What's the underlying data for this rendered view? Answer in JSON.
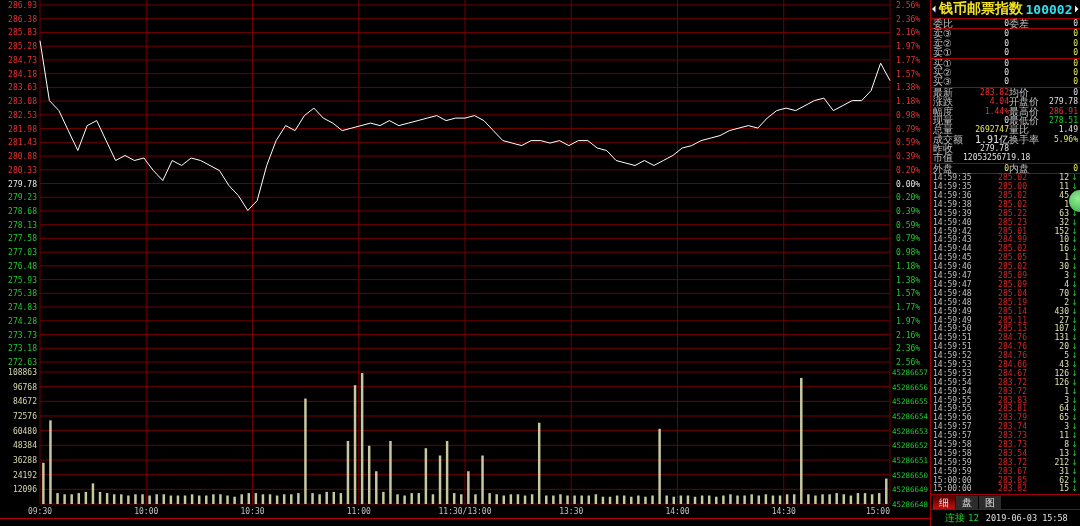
{
  "price_panel": {
    "right_axis": [
      {
        "label": "2.56%",
        "kind": "up"
      },
      {
        "label": "2.36%",
        "kind": "up"
      },
      {
        "label": "2.16%",
        "kind": "up"
      },
      {
        "label": "1.97%",
        "kind": "up"
      },
      {
        "label": "1.77%",
        "kind": "up"
      },
      {
        "label": "1.57%",
        "kind": "up"
      },
      {
        "label": "1.38%",
        "kind": "up"
      },
      {
        "label": "1.18%",
        "kind": "up"
      },
      {
        "label": "0.98%",
        "kind": "up"
      },
      {
        "label": "0.79%",
        "kind": "up"
      },
      {
        "label": "0.59%",
        "kind": "up"
      },
      {
        "label": "0.39%",
        "kind": "up"
      },
      {
        "label": "0.20%",
        "kind": "up"
      },
      {
        "label": "0.00%",
        "kind": "flat"
      },
      {
        "label": "0.20%",
        "kind": "down"
      },
      {
        "label": "0.39%",
        "kind": "down"
      },
      {
        "label": "0.59%",
        "kind": "down"
      },
      {
        "label": "0.79%",
        "kind": "down"
      },
      {
        "label": "0.98%",
        "kind": "down"
      },
      {
        "label": "1.18%",
        "kind": "down"
      },
      {
        "label": "1.38%",
        "kind": "down"
      },
      {
        "label": "1.57%",
        "kind": "down"
      },
      {
        "label": "1.77%",
        "kind": "down"
      },
      {
        "label": "1.97%",
        "kind": "down"
      },
      {
        "label": "2.16%",
        "kind": "down"
      },
      {
        "label": "2.36%",
        "kind": "down"
      },
      {
        "label": "2.56%",
        "kind": "down"
      }
    ],
    "chart_data": {
      "type": "line",
      "grid": true,
      "ylim": [
        272.63,
        286.93
      ],
      "yticks": [
        {
          "value": 286.93,
          "label": "286.93"
        },
        {
          "value": 286.38,
          "label": "286.38"
        },
        {
          "value": 285.83,
          "label": "285.83"
        },
        {
          "value": 285.28,
          "label": "285.28"
        },
        {
          "value": 284.73,
          "label": "284.73"
        },
        {
          "value": 284.18,
          "label": "284.18"
        },
        {
          "value": 283.63,
          "label": "283.63"
        },
        {
          "value": 283.08,
          "label": "283.08"
        },
        {
          "value": 282.53,
          "label": "282.53"
        },
        {
          "value": 281.98,
          "label": "281.98"
        },
        {
          "value": 281.43,
          "label": "281.43"
        },
        {
          "value": 280.88,
          "label": "280.88"
        },
        {
          "value": 280.33,
          "label": "280.33"
        },
        {
          "value": 279.78,
          "label": "279.78"
        },
        {
          "value": 279.23,
          "label": "279.23"
        },
        {
          "value": 278.68,
          "label": "278.68"
        },
        {
          "value": 278.13,
          "label": "278.13"
        },
        {
          "value": 277.58,
          "label": "277.58"
        },
        {
          "value": 277.03,
          "label": "277.03"
        },
        {
          "value": 276.48,
          "label": "276.48"
        },
        {
          "value": 275.93,
          "label": "275.93"
        },
        {
          "value": 275.38,
          "label": "275.38"
        },
        {
          "value": 274.83,
          "label": "274.83"
        },
        {
          "value": 274.28,
          "label": "274.28"
        },
        {
          "value": 273.73,
          "label": "273.73"
        },
        {
          "value": 273.18,
          "label": "273.18"
        },
        {
          "value": 272.63,
          "label": "272.63"
        }
      ],
      "series": [
        {
          "color": "#ffffff",
          "values": [
            285.5,
            283.1,
            282.7,
            281.9,
            281.1,
            282.1,
            282.3,
            281.5,
            280.7,
            280.9,
            280.7,
            280.8,
            280.3,
            279.9,
            280.7,
            280.5,
            280.8,
            280.7,
            280.5,
            280.3,
            279.7,
            279.3,
            278.7,
            279.1,
            280.5,
            281.5,
            282.1,
            281.9,
            282.5,
            282.8,
            282.4,
            282.2,
            281.9,
            282.0,
            282.1,
            282.2,
            282.1,
            282.3,
            282.1,
            282.2,
            282.3,
            282.4,
            282.5,
            282.3,
            282.4,
            282.4,
            282.5,
            282.3,
            281.9,
            281.5,
            281.4,
            281.3,
            281.5,
            281.5,
            281.4,
            281.5,
            281.3,
            281.5,
            281.5,
            281.2,
            281.1,
            280.7,
            280.6,
            280.5,
            280.7,
            280.5,
            280.7,
            280.9,
            281.2,
            281.3,
            281.5,
            281.6,
            281.7,
            281.9,
            282.0,
            282.1,
            282.0,
            282.4,
            282.7,
            282.8,
            282.7,
            282.9,
            283.1,
            283.2,
            282.7,
            282.9,
            283.1,
            283.1,
            283.5,
            284.6,
            283.9
          ]
        }
      ]
    }
  },
  "volume_panel": {
    "right_axis": [
      "45286657",
      "45286656",
      "45286655",
      "45286654",
      "45286653",
      "45286652",
      "45286651",
      "45286650",
      "45286649",
      "45286648"
    ],
    "time_axis": [
      "09:30",
      "10:00",
      "10:30",
      "11:00",
      "11:30/13:00",
      "13:30",
      "14:00",
      "14:30",
      "15:00"
    ],
    "chart_data": {
      "type": "bar",
      "grid": true,
      "ylim": [
        0,
        108863
      ],
      "yticks": [
        {
          "value": 108863,
          "label": "108863"
        },
        {
          "value": 96768,
          "label": "96768"
        },
        {
          "value": 84672,
          "label": "84672"
        },
        {
          "value": 72576,
          "label": "72576"
        },
        {
          "value": 60480,
          "label": "60480"
        },
        {
          "value": 48384,
          "label": "48384"
        },
        {
          "value": 36288,
          "label": "36288"
        },
        {
          "value": 24192,
          "label": "24192"
        },
        {
          "value": 12096,
          "label": "12096"
        }
      ],
      "series": [
        {
          "color": "#c8c8a0",
          "values": [
            34000,
            69000,
            9000,
            8000,
            8000,
            9000,
            10000,
            17000,
            10000,
            9000,
            8000,
            8000,
            7000,
            8000,
            8000,
            7000,
            8000,
            8000,
            7000,
            7000,
            7000,
            8000,
            7000,
            7000,
            8000,
            8000,
            7000,
            6000,
            8000,
            9000,
            9000,
            8000,
            8000,
            7000,
            8000,
            8000,
            9000,
            87000,
            9000,
            8000,
            10000,
            10000,
            9000,
            52000,
            98000,
            108000,
            48000,
            27000,
            10000,
            52000,
            8000,
            7000,
            9000,
            9000,
            46000,
            8000,
            40000,
            52000,
            9000,
            8000,
            27000,
            8000,
            40000,
            9000,
            8000,
            7000,
            8000,
            8000,
            7000,
            8000,
            67000,
            7000,
            7000,
            8000,
            7000,
            7000,
            7000,
            7000,
            8000,
            6000,
            6000,
            7000,
            7000,
            6000,
            7000,
            6000,
            7000,
            62000,
            7000,
            6000,
            7000,
            7000,
            6000,
            7000,
            7000,
            6000,
            7000,
            8000,
            7000,
            7000,
            8000,
            7000,
            8000,
            7000,
            7000,
            8000,
            8000,
            104000,
            8000,
            7000,
            8000,
            8000,
            9000,
            8000,
            7000,
            9000,
            9000,
            8000,
            9000,
            21000
          ]
        }
      ]
    }
  },
  "quote": {
    "title": "钱币邮票指数",
    "code": "100002",
    "sections": [
      [
        [
          {
            "text": "委比",
            "kind": "label"
          },
          {
            "text": "0",
            "kind": "flat"
          },
          {
            "text": "委差",
            "kind": "label"
          },
          {
            "text": "0",
            "kind": "flat"
          }
        ]
      ],
      [
        [
          {
            "text": "卖③",
            "kind": "label"
          },
          {
            "text": "0",
            "kind": "flat"
          },
          {
            "text": "0",
            "kind": "vol"
          }
        ],
        [
          {
            "text": "卖②",
            "kind": "label"
          },
          {
            "text": "0",
            "kind": "flat"
          },
          {
            "text": "0",
            "kind": "vol"
          }
        ],
        [
          {
            "text": "卖①",
            "kind": "label"
          },
          {
            "text": "0",
            "kind": "flat"
          },
          {
            "text": "0",
            "kind": "vol"
          }
        ]
      ],
      [
        [
          {
            "text": "买①",
            "kind": "label"
          },
          {
            "text": "0",
            "kind": "flat"
          },
          {
            "text": "0",
            "kind": "vol"
          }
        ],
        [
          {
            "text": "买②",
            "kind": "label"
          },
          {
            "text": "0",
            "kind": "flat"
          },
          {
            "text": "0",
            "kind": "vol"
          }
        ],
        [
          {
            "text": "买③",
            "kind": "label"
          },
          {
            "text": "0",
            "kind": "flat"
          },
          {
            "text": "0",
            "kind": "vol"
          }
        ]
      ],
      [
        [
          {
            "text": "最新",
            "kind": "label"
          },
          {
            "text": "283.82",
            "kind": "up"
          },
          {
            "text": "均价",
            "kind": "label"
          },
          {
            "text": "0",
            "kind": "flat"
          }
        ],
        [
          {
            "text": "涨跌",
            "kind": "label"
          },
          {
            "text": "4.04",
            "kind": "up"
          },
          {
            "text": "开盘价",
            "kind": "label"
          },
          {
            "text": "279.78",
            "kind": "flat"
          }
        ],
        [
          {
            "text": "幅度",
            "kind": "label"
          },
          {
            "text": "1.44%",
            "kind": "up"
          },
          {
            "text": "最高价",
            "kind": "label"
          },
          {
            "text": "286.91",
            "kind": "up"
          }
        ],
        [
          {
            "text": "现量",
            "kind": "label"
          },
          {
            "text": "0",
            "kind": "flat"
          },
          {
            "text": "最低价",
            "kind": "label"
          },
          {
            "text": "278.51",
            "kind": "down"
          }
        ],
        [
          {
            "text": "总量",
            "kind": "label"
          },
          {
            "text": "2692747",
            "kind": "vol"
          },
          {
            "text": "量比",
            "kind": "label"
          },
          {
            "text": "1.49",
            "kind": "flat"
          }
        ],
        [
          {
            "text": "成交额",
            "kind": "label"
          },
          {
            "text": "1.91亿",
            "kind": "flat"
          },
          {
            "text": "换手率",
            "kind": "label"
          },
          {
            "text": "5.96%",
            "kind": "vol"
          }
        ],
        [
          {
            "text": "昨收",
            "kind": "label"
          },
          {
            "text": "279.78",
            "kind": "flat"
          }
        ],
        [
          {
            "text": "市值",
            "kind": "label"
          },
          {
            "text": "12053256719.18",
            "kind": "wide"
          }
        ]
      ],
      [
        [
          {
            "text": "外盘",
            "kind": "label"
          },
          {
            "text": "0",
            "kind": "vol"
          },
          {
            "text": "内盘",
            "kind": "label"
          },
          {
            "text": "0",
            "kind": "vol"
          }
        ]
      ]
    ],
    "ticks": [
      {
        "time": "14:59:35",
        "price": "285.02",
        "volume": "12",
        "arrow": "↓"
      },
      {
        "time": "14:59:35",
        "price": "285.00",
        "volume": "11",
        "arrow": "↓"
      },
      {
        "time": "14:59:36",
        "price": "285.02",
        "volume": "45"
      },
      {
        "time": "14:59:38",
        "price": "285.02",
        "volume": "1"
      },
      {
        "time": "14:59:39",
        "price": "285.22",
        "volume": "63",
        "arrow": "↓"
      },
      {
        "time": "14:59:40",
        "price": "285.23",
        "volume": "32",
        "arrow": "↓"
      },
      {
        "time": "14:59:42",
        "price": "285.01",
        "volume": "152",
        "arrow": "↓"
      },
      {
        "time": "14:59:43",
        "price": "284.99",
        "volume": "10",
        "arrow": "↓"
      },
      {
        "time": "14:59:44",
        "price": "285.02",
        "volume": "16",
        "arrow": "↓"
      },
      {
        "time": "14:59:45",
        "price": "285.05",
        "volume": "1",
        "arrow": "↓"
      },
      {
        "time": "14:59:46",
        "price": "285.02",
        "volume": "30",
        "arrow": "↓"
      },
      {
        "time": "14:59:47",
        "price": "285.09",
        "volume": "3",
        "arrow": "↓"
      },
      {
        "time": "14:59:47",
        "price": "285.09",
        "volume": "4",
        "arrow": "↓"
      },
      {
        "time": "14:59:48",
        "price": "285.04",
        "volume": "70",
        "arrow": "↓"
      },
      {
        "time": "14:59:48",
        "price": "285.19",
        "volume": "2",
        "arrow": "↓"
      },
      {
        "time": "14:59:49",
        "price": "285.14",
        "volume": "430",
        "arrow": "↓"
      },
      {
        "time": "14:59:49",
        "price": "285.11",
        "volume": "27",
        "arrow": "↓"
      },
      {
        "time": "14:59:50",
        "price": "285.13",
        "volume": "107",
        "arrow": "↓"
      },
      {
        "time": "14:59:51",
        "price": "284.76",
        "volume": "131",
        "arrow": "↓"
      },
      {
        "time": "14:59:51",
        "price": "284.76",
        "volume": "20",
        "arrow": "↓"
      },
      {
        "time": "14:59:52",
        "price": "284.76",
        "volume": "5",
        "arrow": "↓"
      },
      {
        "time": "14:59:53",
        "price": "284.66",
        "volume": "43",
        "arrow": "↓"
      },
      {
        "time": "14:59:53",
        "price": "284.67",
        "volume": "126",
        "arrow": "↓"
      },
      {
        "time": "14:59:54",
        "price": "283.72",
        "volume": "126",
        "arrow": "↓"
      },
      {
        "time": "14:59:54",
        "price": "283.72",
        "volume": "1",
        "arrow": "↓"
      },
      {
        "time": "14:59:55",
        "price": "283.83",
        "volume": "3",
        "arrow": "↓"
      },
      {
        "time": "14:59:55",
        "price": "283.81",
        "volume": "64",
        "arrow": "↓"
      },
      {
        "time": "14:59:56",
        "price": "283.79",
        "volume": "65",
        "arrow": "↓"
      },
      {
        "time": "14:59:57",
        "price": "283.74",
        "volume": "3",
        "arrow": "↓"
      },
      {
        "time": "14:59:57",
        "price": "283.73",
        "volume": "11",
        "arrow": "↓"
      },
      {
        "time": "14:59:58",
        "price": "283.73",
        "volume": "8",
        "arrow": "↓"
      },
      {
        "time": "14:59:58",
        "price": "283.54",
        "volume": "13",
        "arrow": "↓"
      },
      {
        "time": "14:59:59",
        "price": "283.72",
        "volume": "212",
        "arrow": "↓"
      },
      {
        "time": "14:59:59",
        "price": "283.67",
        "volume": "31",
        "arrow": "↓"
      },
      {
        "time": "15:00:00",
        "price": "283.85",
        "volume": "62",
        "arrow": "↓"
      },
      {
        "time": "15:00:00",
        "price": "283.82",
        "volume": "15",
        "arrow": "↓"
      }
    ],
    "tabs": [
      {
        "label": "细",
        "selected": true
      },
      {
        "label": "盘",
        "selected": false
      },
      {
        "label": "图",
        "selected": false
      }
    ],
    "status": {
      "label": "连接",
      "count": "12",
      "datetime": "2019-06-03 15:58"
    }
  }
}
